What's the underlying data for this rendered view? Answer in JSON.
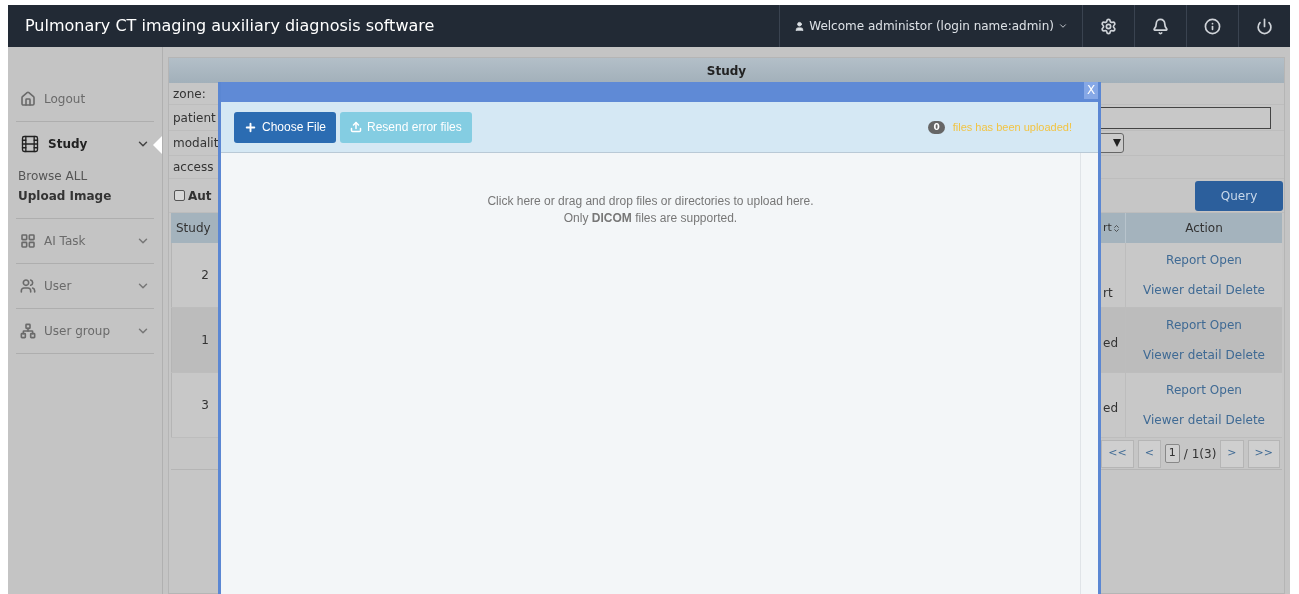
{
  "header": {
    "title": "Pulmonary CT imaging auxiliary diagnosis software",
    "user": "Welcome administor (login name:admin)"
  },
  "sidebar": {
    "items": [
      {
        "label": "Logout",
        "kind": "link"
      },
      {
        "label": "Study",
        "kind": "menu",
        "expanded": true,
        "children": [
          {
            "label": "Browse ALL",
            "selected": false
          },
          {
            "label": "Upload Image",
            "selected": true
          }
        ]
      },
      {
        "label": "AI Task",
        "kind": "menu",
        "expanded": false
      },
      {
        "label": "User",
        "kind": "menu",
        "expanded": false
      },
      {
        "label": "User group",
        "kind": "menu",
        "expanded": false
      }
    ]
  },
  "main": {
    "title": "Study",
    "form_labels": [
      "zone:",
      "patient",
      "modalit",
      "access"
    ],
    "auto_checkbox": {
      "label": "Aut",
      "checked": false
    },
    "query_button": "Query",
    "table": {
      "columns": [
        "Study",
        "rt",
        "Action"
      ],
      "rows": [
        {
          "study": "2",
          "column_2": "rt",
          "actions": [
            "Report",
            "Open",
            "Viewer",
            "detail",
            "Delete"
          ]
        },
        {
          "study": "1",
          "column_2": "ed",
          "actions": [
            "Report",
            "Open",
            "Viewer",
            "detail",
            "Delete"
          ]
        },
        {
          "study": "3",
          "column_2": "ed",
          "actions": [
            "Report",
            "Open",
            "Viewer",
            "detail",
            "Delete"
          ]
        }
      ]
    },
    "pagination": {
      "first": "<<",
      "prev": "<",
      "page": "1",
      "total": "/ 1(3)",
      "next": ">",
      "last": ">>"
    }
  },
  "modal": {
    "close": "X",
    "choose_button": "Choose File",
    "resend_button": {
      "label": "Resend error files",
      "disabled": true
    },
    "count": "0",
    "count_text": "files has been uploaded!",
    "drop_lines": [
      "Click here or drag and drop files or directories to upload here.",
      "Only **DICOM** files are supported."
    ]
  }
}
